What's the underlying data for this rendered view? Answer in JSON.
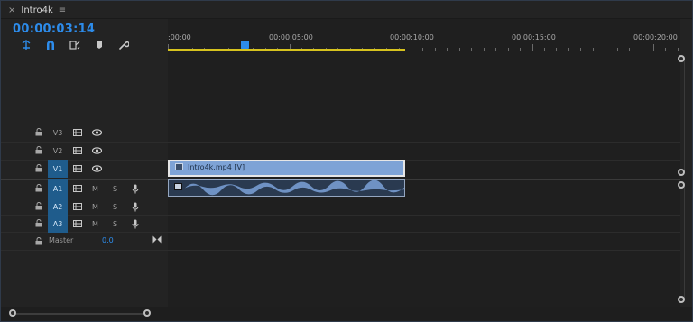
{
  "tab": {
    "close": "×",
    "title": "Intro4k",
    "menu": "≡"
  },
  "timecode": "00:00:03:14",
  "tools": [
    "insert-overwrite-icon",
    "snap-magnet-icon",
    "linked-selection-icon",
    "add-marker-icon",
    "settings-wrench-icon"
  ],
  "ruler": {
    "labels": [
      ":00:00",
      "00:00:05:00",
      "00:00:10:00",
      "00:00:15:00",
      "00:00:20:00"
    ]
  },
  "video_tracks": [
    {
      "name": "V3",
      "active": false
    },
    {
      "name": "V2",
      "active": false
    },
    {
      "name": "V1",
      "active": true
    }
  ],
  "audio_tracks": [
    {
      "name": "A1",
      "active": true,
      "m": "M",
      "s": "S"
    },
    {
      "name": "A2",
      "active": true,
      "m": "M",
      "s": "S"
    },
    {
      "name": "A3",
      "active": true,
      "m": "M",
      "s": "S"
    }
  ],
  "master": {
    "label": "Master",
    "value": "0.0"
  },
  "clips": {
    "video_label": "Intro4k.mp4 [V]"
  },
  "colors": {
    "accent": "#2d8ceb",
    "work_area": "#d6c21e",
    "video_clip": "#7ea3d6",
    "audio_clip": "#2a3a50",
    "active_track": "#1f5c8c"
  }
}
